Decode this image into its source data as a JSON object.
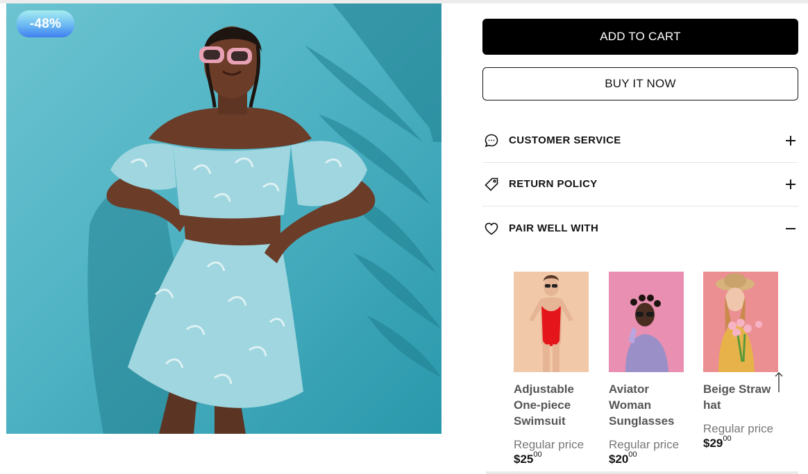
{
  "product": {
    "badge": "-48%",
    "image_icon": "model-in-blue-floral-two-piece-photo"
  },
  "actions": {
    "add_to_cart": "ADD TO CART",
    "buy_now": "BUY IT NOW"
  },
  "accordion": [
    {
      "label": "CUSTOMER SERVICE",
      "icon": "chat-bubble-icon",
      "state": "collapsed"
    },
    {
      "label": "RETURN POLICY",
      "icon": "price-tag-icon",
      "state": "collapsed"
    },
    {
      "label": "PAIR WELL WITH",
      "icon": "heart-icon",
      "state": "expanded"
    }
  ],
  "pair_products": [
    {
      "name": "Adjustable One-piece Swimsuit",
      "price_label": "Regular price",
      "price_main": "$25",
      "price_cents": "00",
      "thumb_color": "#f1c9a9"
    },
    {
      "name": "Aviator Woman Sunglasses",
      "price_label": "Regular price",
      "price_main": "$20",
      "price_cents": "00",
      "thumb_color": "#e98fb1"
    },
    {
      "name": "Beige Straw hat",
      "price_label": "Regular price",
      "price_main": "$29",
      "price_cents": "00",
      "thumb_color": "#ec8f93"
    }
  ],
  "colors": {
    "hero_bg": "#4fb3c4",
    "button_dark": "#000000",
    "badge_gradient_top": "#a6ecf0",
    "badge_gradient_bottom": "#3f7ff0"
  }
}
